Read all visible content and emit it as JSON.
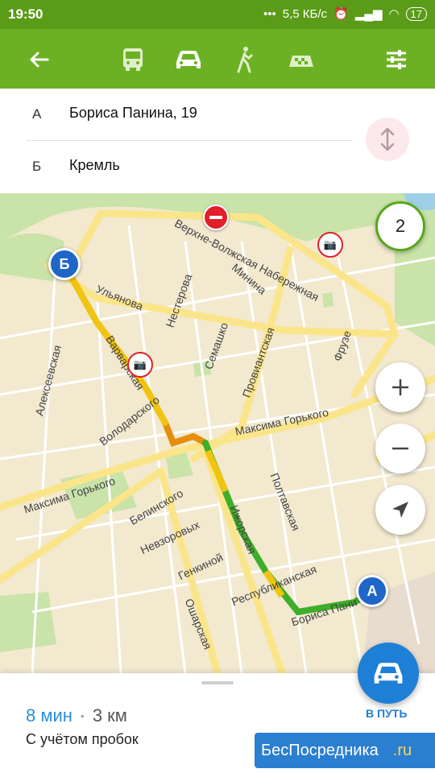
{
  "status_bar": {
    "time": "19:50",
    "network_speed": "5,5 КБ/с",
    "battery": "17"
  },
  "toolbar": {
    "back_icon": "arrow-left-icon",
    "modes": [
      "bus-icon",
      "car-icon",
      "walk-icon",
      "taxi-icon"
    ],
    "selected_mode": "car-icon",
    "settings_icon": "sliders-icon"
  },
  "route": {
    "from_letter": "А",
    "from_address": "Бориса Панина, 19",
    "to_letter": "Б",
    "to_address": "Кремль"
  },
  "map": {
    "route_count_badge": "2",
    "marker_a": "А",
    "marker_b": "Б",
    "streets": [
      "Верхне-Волжская Набережная",
      "Минина",
      "Ульянова",
      "Нестерова",
      "Семашко",
      "Провиантская",
      "Фрузе",
      "Алексеевская",
      "Варварская",
      "Володарского",
      "Максима Горького",
      "Максима Горького",
      "Белинского",
      "Невзоровых",
      "Генкиной",
      "Ижорская",
      "Полтавская",
      "Республиканская",
      "Ошарская",
      "Бориса Пани"
    ]
  },
  "eta": {
    "time": "8 мин",
    "separator": "•",
    "distance": "3 км",
    "note": "С учётом пробок"
  },
  "go_button": {
    "label": "В ПУТЬ"
  },
  "watermark": {
    "text": "БесПосредника",
    "suffix": ".ru"
  },
  "colors": {
    "toolbar": "#6cb123",
    "accent_blue": "#1e7fd6",
    "route_green": "#3fae2a",
    "route_yellow": "#f1c40f",
    "route_orange": "#e58e0b"
  }
}
